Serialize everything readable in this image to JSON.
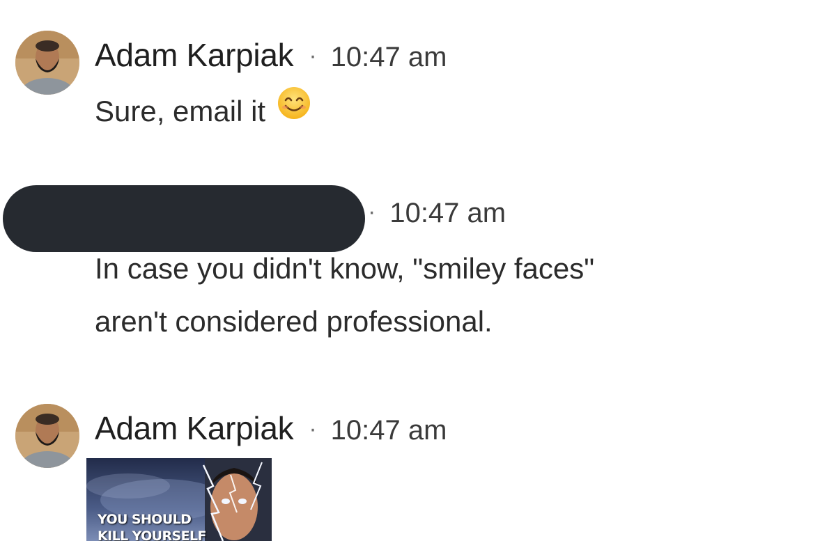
{
  "messages": [
    {
      "sender": "Adam Karpiak",
      "time": "10:47 am",
      "lines": [
        "Sure, email it"
      ],
      "emoji": "smiling-face-emoji"
    },
    {
      "sender_redacted": true,
      "time": "10:47 am",
      "lines": [
        "In case you didn't know, \"smiley faces\"",
        "aren't considered professional."
      ]
    },
    {
      "sender": "Adam Karpiak",
      "time": "10:47 am",
      "attachment": {
        "caption_line1": "YOU SHOULD",
        "caption_line2": "KILL YOURSELF"
      }
    }
  ],
  "separator": "·",
  "colors": {
    "redaction": "#262a30",
    "text": "#2b2b2b",
    "meta": "#3a3a3a"
  }
}
